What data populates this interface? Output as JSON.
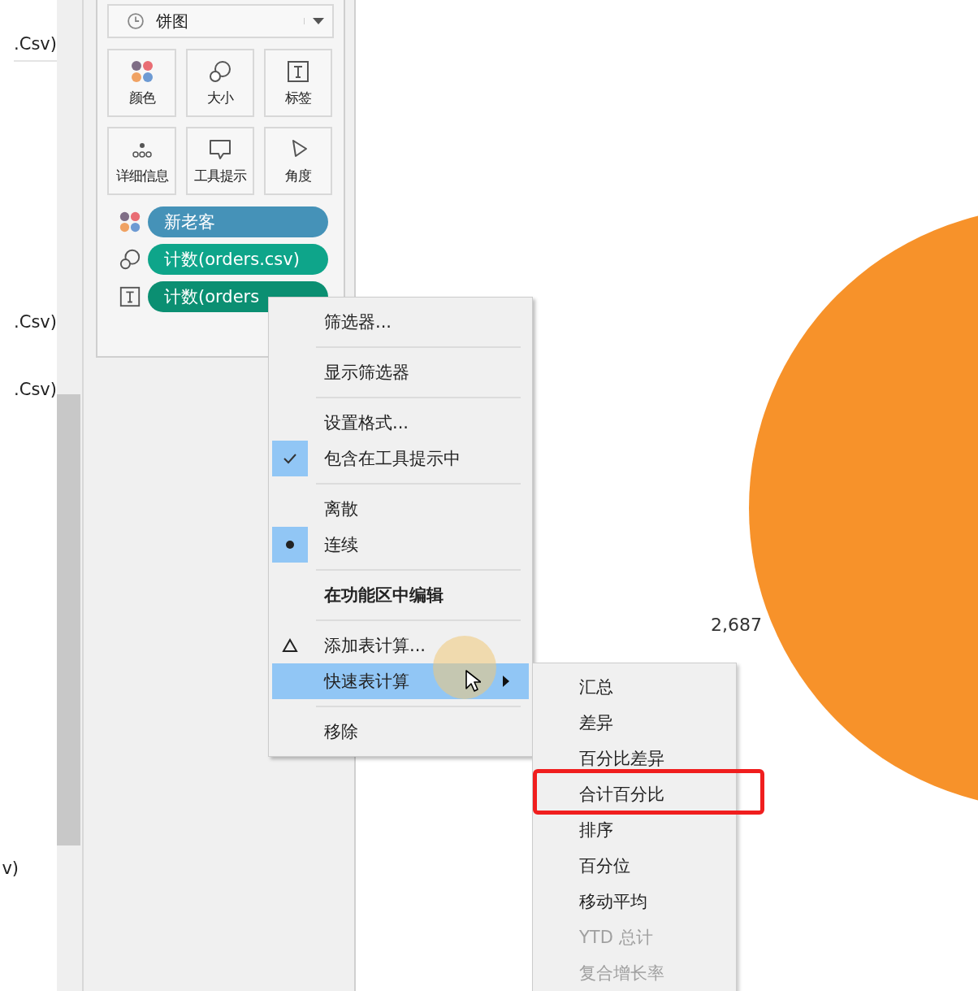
{
  "field_list": [
    ".Csv)",
    ".Csv)",
    ".Csv)",
    "v)"
  ],
  "marks_card": {
    "mark_type": "饼图",
    "buttons": [
      {
        "label": "颜色",
        "kind": "color"
      },
      {
        "label": "大小",
        "kind": "size"
      },
      {
        "label": "标签",
        "kind": "label"
      },
      {
        "label": "详细信息",
        "kind": "detail"
      },
      {
        "label": "工具提示",
        "kind": "tooltip"
      },
      {
        "label": "角度",
        "kind": "angle"
      }
    ],
    "pills": [
      {
        "label": "新老客",
        "kind": "color",
        "color": "#4592b8"
      },
      {
        "label": "计数(orders.csv)",
        "kind": "size",
        "color": "#0ea58a"
      },
      {
        "label": "计数(orders",
        "kind": "label",
        "color": "#0b8f72"
      }
    ]
  },
  "canvas": {
    "pie_label": "2,687"
  },
  "context_menu": {
    "groups": [
      [
        {
          "label": "筛选器...",
          "kind": "command",
          "highlighted": false
        }
      ],
      [
        {
          "label": "显示筛选器",
          "kind": "command",
          "highlighted": false
        }
      ],
      [
        {
          "label": "设置格式...",
          "kind": "command",
          "highlighted": false
        },
        {
          "label": "包含在工具提示中",
          "kind": "toggle",
          "checked": true,
          "highlighted": false
        }
      ],
      [
        {
          "label": "离散",
          "kind": "radio",
          "selected": false,
          "highlighted": false
        },
        {
          "label": "连续",
          "kind": "radio",
          "selected": true,
          "highlighted": false
        }
      ],
      [
        {
          "label": "在功能区中编辑",
          "kind": "emphasis",
          "highlighted": false
        }
      ],
      [
        {
          "label": "添加表计算...",
          "kind": "calc",
          "highlighted": false
        },
        {
          "label": "快速表计算",
          "kind": "submenu",
          "highlighted": true
        }
      ],
      [
        {
          "label": "移除",
          "kind": "command",
          "highlighted": false
        }
      ]
    ]
  },
  "submenu": {
    "items": [
      {
        "label": "汇总",
        "disabled": false,
        "annotated": false
      },
      {
        "label": "差异",
        "disabled": false,
        "annotated": false
      },
      {
        "label": "百分比差异",
        "disabled": false,
        "annotated": false
      },
      {
        "label": "合计百分比",
        "disabled": false,
        "annotated": true
      },
      {
        "label": "排序",
        "disabled": false,
        "annotated": false
      },
      {
        "label": "百分位",
        "disabled": false,
        "annotated": false
      },
      {
        "label": "移动平均",
        "disabled": false,
        "annotated": false
      },
      {
        "label": "YTD 总计",
        "disabled": true,
        "annotated": false
      },
      {
        "label": "复合增长率",
        "disabled": true,
        "annotated": false
      }
    ]
  }
}
